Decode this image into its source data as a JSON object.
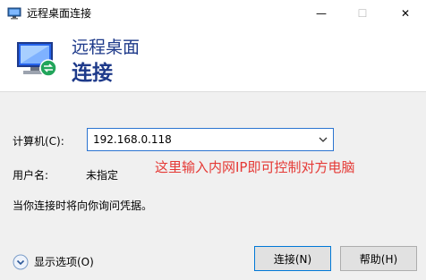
{
  "window": {
    "title": "远程桌面连接",
    "minimize_glyph": "—",
    "maximize_glyph": "☐",
    "close_glyph": "✕"
  },
  "banner": {
    "title": "远程桌面",
    "subtitle": "连接"
  },
  "form": {
    "computer_label": "计算机(C):",
    "computer_value": "192.168.0.118",
    "username_label": "用户名:",
    "username_value": "未指定",
    "info_text": "当你连接时将向你询问凭据。"
  },
  "annotation": "这里输入内网IP即可控制对方电脑",
  "footer": {
    "show_options_label": "显示选项(O)",
    "connect_label": "连接(N)",
    "help_label": "帮助(H)"
  },
  "icons": {
    "app": "remote-desktop-icon",
    "options": "chevron-down-circle-icon",
    "combo": "chevron-down-icon"
  },
  "colors": {
    "banner_text": "#1e3a8a",
    "annotation": "#e53935",
    "focus_border": "#0078d7"
  }
}
